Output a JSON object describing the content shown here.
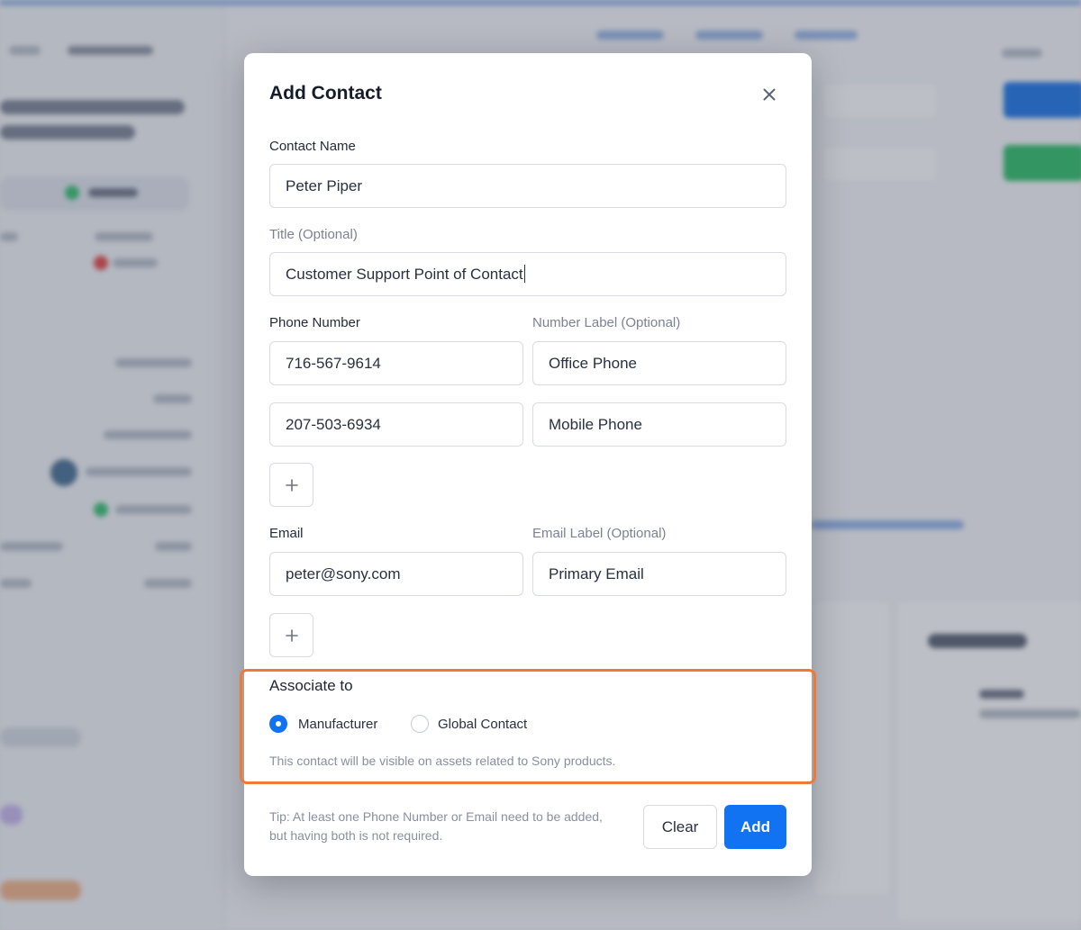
{
  "modal": {
    "title": "Add Contact",
    "contact_name": {
      "label": "Contact Name",
      "value": "Peter Piper"
    },
    "title_field": {
      "label": "Title (Optional)",
      "value": "Customer Support Point of Contact"
    },
    "phone": {
      "label": "Phone Number",
      "number_label": "Number Label (Optional)",
      "rows": [
        {
          "number": "716-567-9614",
          "label": "Office Phone"
        },
        {
          "number": "207-503-6934",
          "label": "Mobile Phone"
        }
      ]
    },
    "email": {
      "label": "Email",
      "email_label": "Email Label (Optional)",
      "rows": [
        {
          "address": "peter@sony.com",
          "label": "Primary Email"
        }
      ]
    },
    "associate": {
      "heading": "Associate to",
      "options": [
        {
          "label": "Manufacturer",
          "selected": true
        },
        {
          "label": "Global Contact",
          "selected": false
        }
      ],
      "hint": "This contact will be visible on assets related to Sony products."
    },
    "tip": "Tip: At least one Phone Number or Email need to be added, but having both is not required.",
    "buttons": {
      "clear": "Clear",
      "add": "Add"
    }
  },
  "colors": {
    "primary": "#1273f2",
    "highlight": "#f0793a"
  },
  "icons": [
    "close-icon",
    "plus-icon",
    "plus-icon"
  ]
}
